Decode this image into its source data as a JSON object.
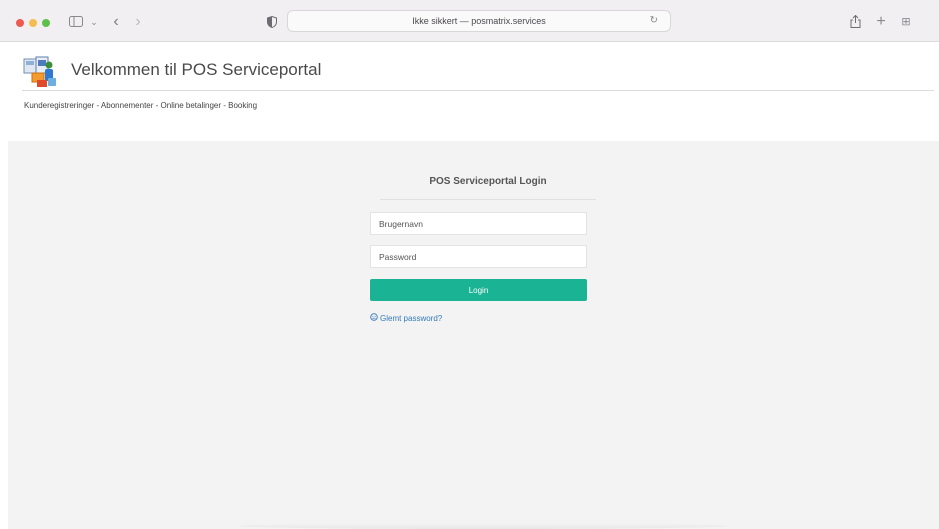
{
  "browser": {
    "address": "Ikke sikkert — posmatrix.services",
    "icons": {
      "sidebar": "sidebar-icon",
      "back": "chevron-left-icon",
      "forward": "chevron-right-icon",
      "privacy": "shield-icon",
      "reload": "reload-icon",
      "share": "share-icon",
      "new_tab": "plus-icon",
      "tab_overview": "tabs-grid-icon"
    }
  },
  "header": {
    "title": "Velkommen til POS Serviceportal",
    "tagline": "Kunderegistreringer - Abonnementer - Online betalinger - Booking"
  },
  "login": {
    "title": "POS Serviceportal Login",
    "username_placeholder": "Brugernavn",
    "password_placeholder": "Password",
    "button_label": "Login",
    "forgot_label": "Glemt password?"
  },
  "colors": {
    "accent": "#1ab394",
    "link": "#337ab7",
    "background": "#f3f3f4"
  }
}
